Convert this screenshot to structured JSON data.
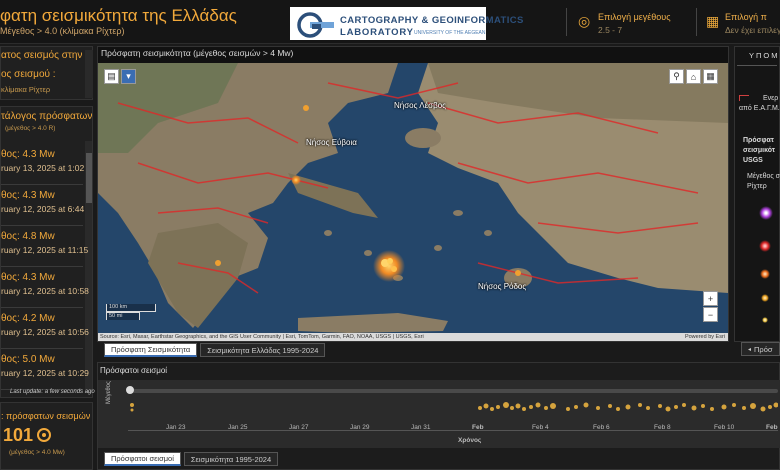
{
  "header": {
    "title": "φατη σεισμικότητα της Ελλάδας",
    "subtitle": "Μέγεθος > 4.0 (κλίμακα Ρίχτερ)",
    "logo": {
      "line1": "CARTOGRAPHY & GEOINFORMATICS",
      "line2": "LABORATORY",
      "line3": "UNIVERSITY OF THE AEGEAN"
    },
    "magnitude_filter": {
      "label": "Επιλογή μεγέθους",
      "value": "2.5 - 7",
      "icon": "gauge-icon"
    },
    "period_filter": {
      "label": "Επιλογή π",
      "value": "Δεν έχει επιλεγε",
      "icon": "calendar-icon"
    }
  },
  "left": {
    "top_panel": {
      "heading1": "ατος σεισμός στην",
      "heading2": "ος σεισμού :",
      "sub": "κλίμακα Ρίχτερ"
    },
    "list_panel": {
      "heading": "τάλογος πρόσφατων",
      "sub": "(μέγεθος > 4.0 R)",
      "items": [
        {
          "mag": "θος: 4.3 Mw",
          "date": "ruary 13, 2025 at 1:02"
        },
        {
          "mag": "θος: 4.3 Mw",
          "date": "ruary 12, 2025 at 6:44"
        },
        {
          "mag": "θος: 4.8 Mw",
          "date": "ruary 12, 2025 at 11:15"
        },
        {
          "mag": "θος: 4.3 Mw",
          "date": "ruary 12, 2025 at 10:58"
        },
        {
          "mag": "θος: 4.2 Mw",
          "date": "ruary 12, 2025 at 10:56"
        },
        {
          "mag": "θος: 5.0 Mw",
          "date": "ruary 12, 2025 at 10:29"
        }
      ],
      "last_update": "Last update: a few seconds ago"
    },
    "count_panel": {
      "heading": ": πρόσφατων σεισμών",
      "count": "101",
      "sub": "(μέγεθος > 4.0 Mw)"
    }
  },
  "map": {
    "title": "Πρόσφατη σεισμικότητα (μέγεθος σεισμών > 4 Mw)",
    "places": [
      "Νήσος Λέσβος",
      "Νήσος Εύβοια",
      "Νήσος Ρόδος"
    ],
    "scale": [
      "100 km",
      "50 mi"
    ],
    "attribution": "Source: Esri, Maxar, Earthstar Geographics, and the GIS User Community | Esri, TomTom, Garmin, FAO, NOAA, USGS | USGS, Esri",
    "powered_by": "Powered by Esri",
    "zoom_in": "+",
    "zoom_out": "−",
    "tabs": [
      "Πρόσφατη Σεισμικότητα",
      "Σεισμικότητα Ελλάδας 1995-2024"
    ]
  },
  "legend": {
    "heading": "ΥΠΟΜ",
    "line1": "Ενερ",
    "line2": "από Ε.Α.Γ.Μ.",
    "usgs1": "Πρόσφατ",
    "usgs2": "σεισμικότ",
    "usgs3": "USGS",
    "size1": "Μέγεθος σ",
    "size2": "Ρίχτερ",
    "colors": [
      "#b040e0",
      "#e02828",
      "#e86a1a",
      "#e8a020",
      "#e8c040"
    ],
    "back_btn": "Πρόσ"
  },
  "timeline": {
    "title": "Πρόσφατοι σεισμοί",
    "ylabel": "Μέγεθος",
    "xlabel": "Χρόνος",
    "ticks": [
      "Jan 23",
      "Jan 25",
      "Jan 27",
      "Jan 29",
      "Jan 31",
      "Feb",
      "Feb 4",
      "Feb 6",
      "Feb 8",
      "Feb 10",
      "Feb"
    ],
    "tabs": [
      "Πρόσφατοι σεισμοί",
      "Σεισμικότητα 1995-2024"
    ]
  }
}
